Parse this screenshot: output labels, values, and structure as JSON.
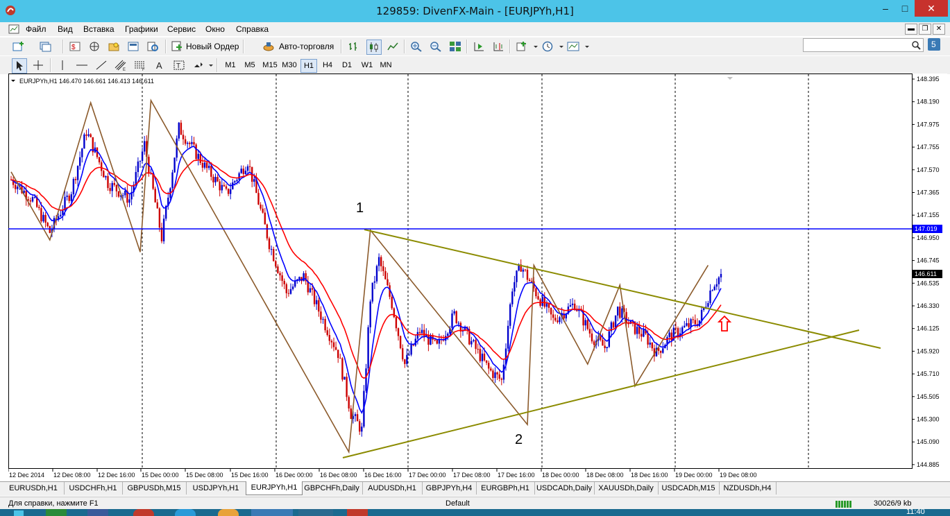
{
  "window": {
    "title": "129859: DivenFX-Main - [EURJPYh,H1]",
    "minimize": "–",
    "maximize": "□",
    "close": "✕"
  },
  "menu": [
    "Файл",
    "Вид",
    "Вставка",
    "Графики",
    "Сервис",
    "Окно",
    "Справка"
  ],
  "toolbar": {
    "new_order": "Новый Ордер",
    "auto_trading": "Авто-торговля"
  },
  "timeframes": [
    "M1",
    "M5",
    "M15",
    "M30",
    "H1",
    "H4",
    "D1",
    "W1",
    "MN"
  ],
  "active_timeframe": "H1",
  "chart": {
    "info": "EURJPYh,H1  146.470 146.661 146.413 146.611",
    "price_ticks": [
      "148.395",
      "148.190",
      "147.975",
      "147.755",
      "147.570",
      "147.365",
      "147.155",
      "146.950",
      "146.745",
      "146.535",
      "146.330",
      "146.125",
      "145.920",
      "145.710",
      "145.505",
      "145.300",
      "145.090",
      "144.885"
    ],
    "hline_price": "147.019",
    "current_price": "146.611",
    "time_ticks": [
      "12 Dec 2014",
      "12 Dec 08:00",
      "12 Dec 16:00",
      "15 Dec 00:00",
      "15 Dec 08:00",
      "15 Dec 16:00",
      "16 Dec 00:00",
      "16 Dec 08:00",
      "16 Dec 16:00",
      "17 Dec 00:00",
      "17 Dec 08:00",
      "17 Dec 16:00",
      "18 Dec 00:00",
      "18 Dec 08:00",
      "18 Dec 16:00",
      "19 Dec 00:00",
      "19 Dec 08:00"
    ],
    "annotation_1": "1",
    "annotation_2": "2",
    "colors": {
      "bull": "#0000cc",
      "bear": "#cc0000",
      "ma_fast": "#0000ff",
      "ma_slow": "#ff0000",
      "zigzag": "#8b5a2b",
      "triangle": "#8b8b00",
      "hline": "#0000ff",
      "arrow": "#ff0000"
    }
  },
  "tabs": [
    "EURUSDh,H1",
    "USDCHFh,H1",
    "GBPUSDh,M15",
    "USDJPYh,H1",
    "EURJPYh,H1",
    "GBPCHFh,Daily",
    "AUDUSDh,H1",
    "GBPJPYh,H4",
    "EURGBPh,H1",
    "USDCADh,Daily",
    "XAUUSDh,Daily",
    "USDCADh,M15",
    "NZDUSDh,H4"
  ],
  "active_tab": "EURJPYh,H1",
  "status": {
    "help": "Для справки, нажмите F1",
    "profile": "Default",
    "traffic": "30026/9 kb"
  },
  "taskbar": {
    "clock": "11:40"
  }
}
